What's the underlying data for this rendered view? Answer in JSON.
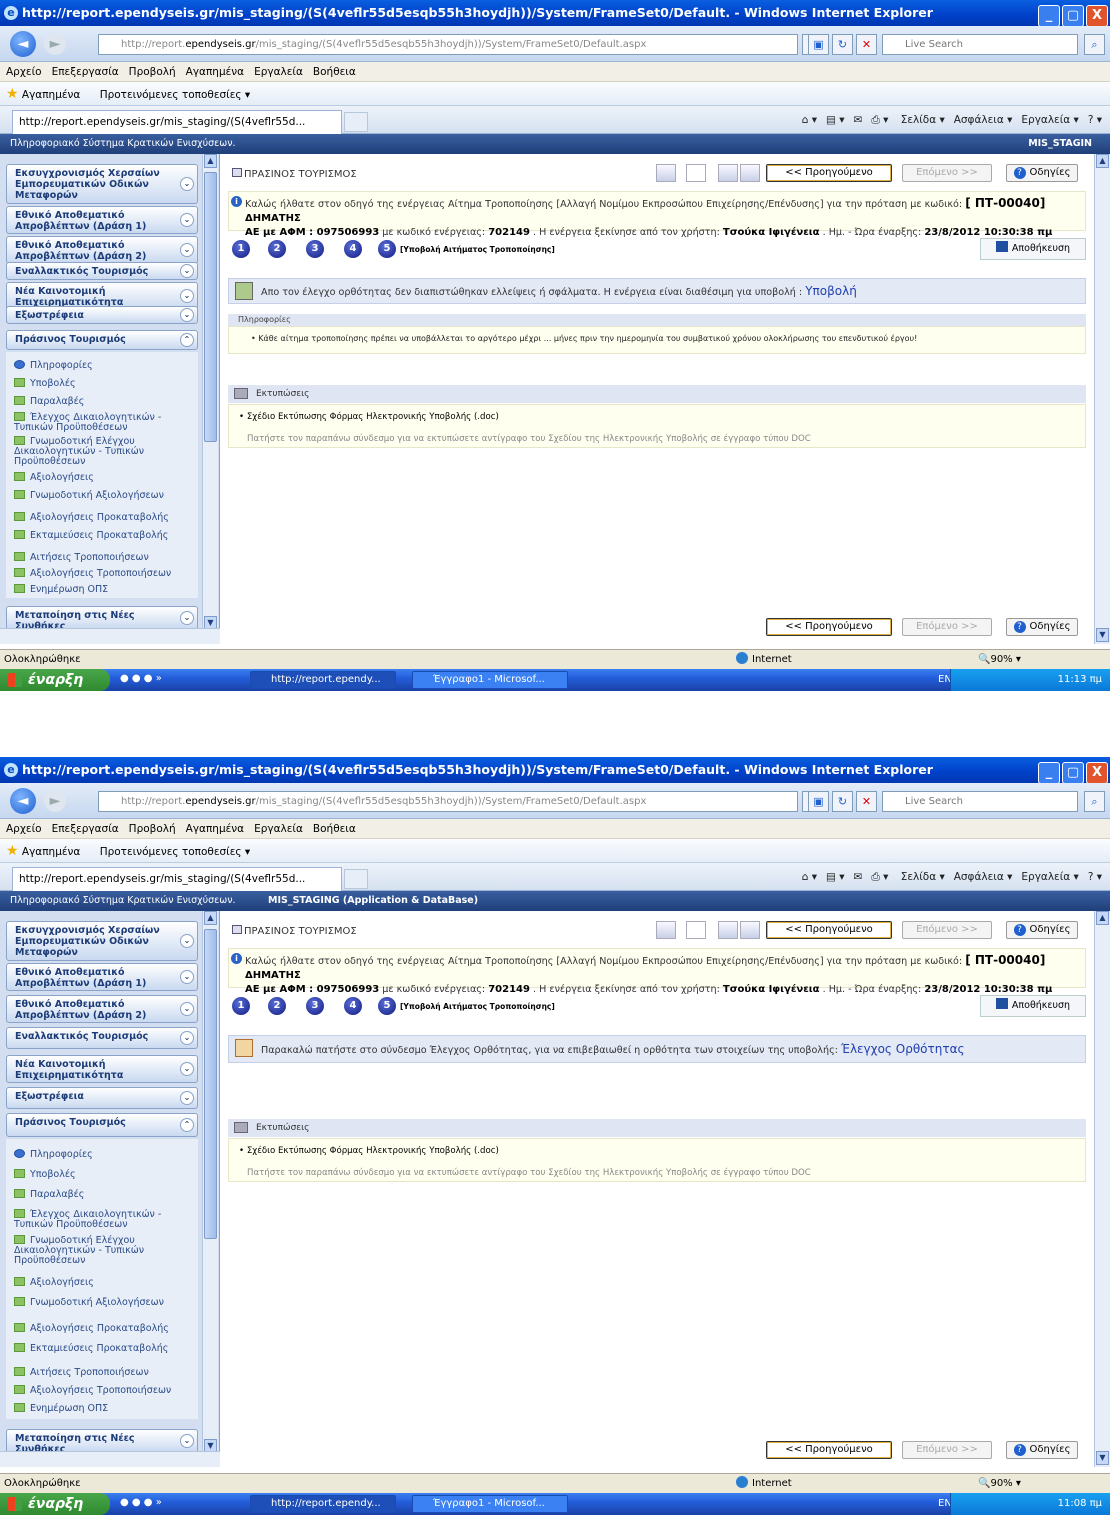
{
  "window": {
    "title": "http://report.ependyseis.gr/mis_staging/(S(4veflr55d5esqb55h3hoydjh))/System/FrameSet0/Default. - Windows Internet Explorer",
    "min": "_",
    "max": "▢",
    "close": "X"
  },
  "address": {
    "url_prefix": "http://report.",
    "url_domain": "ependyseis.gr",
    "url_rest": "/mis_staging/(S(4veflr55d5esqb55h3hoydjh))/System/FrameSet0/Default.aspx",
    "search_placeholder": "Live Search"
  },
  "menu": [
    "Αρχείο",
    "Επεξεργασία",
    "Προβολή",
    "Αγαπημένα",
    "Εργαλεία",
    "Βοήθεια"
  ],
  "favorites": {
    "label": "Αγαπημένα",
    "suggested": "Προτεινόμενες τοποθεσίες ▾"
  },
  "tab": {
    "label": "http://report.ependyseis.gr/mis_staging/(S(4veflr55d..."
  },
  "commandbar": {
    "page": "Σελίδα ▾",
    "safety": "Ασφάλεια ▾",
    "tools": "Εργαλεία ▾"
  },
  "app": {
    "header_title": "Πληροφοριακό Σύστημα Κρατικών Ενισχύσεων.",
    "system_top": "MIS_STAGIN",
    "system_bottom": "MIS_STAGING (Application & DataBase)"
  },
  "sidebar": {
    "sections": [
      {
        "label": "Εκσυγχρονισμός Χερσαίων Εμπορευματικών Οδικών Μεταφορών"
      },
      {
        "label": "Εθνικό Αποθεματικό Απροβλέπτων (Δράση 1)"
      },
      {
        "label": "Εθνικό Αποθεματικό Απροβλέπτων (Δράση 2)"
      },
      {
        "label": "Εναλλακτικός Τουρισμός"
      },
      {
        "label": "Νέα Καινοτομική Επιχειρηματικότητα"
      },
      {
        "label": "Εξωστρέφεια"
      },
      {
        "label": "Πράσινος Τουρισμός"
      },
      {
        "label": "Μεταποίηση στις Νέες Συνθήκες"
      }
    ],
    "items": [
      "Πληροφορίες",
      "Υποβολές",
      "Παραλαβές",
      "Έλεγχος Δικαιολογητικών - Τυπικών Προϋποθέσεων",
      "Γνωμοδοτική Ελέγχου Δικαιολογητικών - Τυπικών Προϋποθέσεων",
      "Αξιολογήσεις",
      "Γνωμοδοτική Αξιολογήσεων",
      "Αξιολογήσεις Προκαταβολής",
      "Εκταμιεύσεις Προκαταβολής",
      "Αιτήσεις Τροποποιήσεων",
      "Αξιολογήσεις Τροποποιήσεων",
      "Ενημέρωση ΟΠΣ"
    ]
  },
  "content": {
    "title": "ΠΡΑΣΙΝΟΣ ΤΟΥΡΙΣΜΟΣ",
    "prev": "<< Προηγούμενο",
    "next": "Επόμενο >>",
    "help": "Οδηγίες",
    "welcome_1": "Καλώς ήλθατε στον οδηγό της ενέργειας Αίτημα Τροποποίησης [Αλλαγή Νομίμου Εκπροσώπου Επιχείρησης/Επένδυσης] για την πρόταση με κωδικό:",
    "code": "[ ΠΤ-00040]",
    "company": "ΔΗΜΑΤΗΣ",
    "company_2": "ΑΕ με ΑΦΜ : 097506993",
    "welcome_2": "με κωδικό ενέργειας:",
    "action_code": "702149",
    "welcome_3": ". Η ενέργεια ξεκίνησε από τον χρήστη:",
    "user": "Τσούκα Ιφιγένεια",
    "welcome_4": ". Ημ. - Ώρα έναρξης:",
    "start_dt": "23/8/2012 10:30:38 πμ",
    "steps": [
      "1",
      "2",
      "3",
      "4",
      "5"
    ],
    "step_label": "[Υποβολή Αιτήματος Τροποποίησης]",
    "save": "Αποθήκευση",
    "msg_ok": "Απο τον έλεγχο ορθότητας δεν διαπιστώθηκαν ελλείψεις ή σφάλματα. Η ενέργεια είναι διαθέσιμη για υποβολή :",
    "msg_ok_link": "Υποβολή",
    "info_head": "Πληροφορίες",
    "info_text": "Κάθε αίτημα τροποποίησης πρέπει να υποβάλλεται το αργότερο μέχρι ... μήνες πριν την ημερομηνία του συμβατικού χρόνου ολοκλήρωσης του επενδυτικού έργου!",
    "msg_check": "Παρακαλώ πατήστε στο σύνδεσμο Έλεγχος Ορθότητας, για να επιβεβαιωθεί η ορθότητα των στοιχείων της υποβολής:",
    "msg_check_link": "Έλεγχος Ορθότητας",
    "prints_head": "Εκτυπώσεις",
    "prints_link": "Σχέδιο Εκτύπωσης Φόρμας Ηλεκτρονικής Υποβολής (.doc)",
    "prints_sub": "Πατήστε τον παραπάνω σύνδεσμο για να εκτυπώσετε αντίγραφο του Σχεδίου της Ηλεκτρονικής Υποβολής σε έγγραφο τύπου DOC"
  },
  "status": {
    "done": "Ολοκληρώθηκε",
    "zone": "Internet",
    "zoom": "90%"
  },
  "taskbar": {
    "start": "έναρξη",
    "task_ie": "http://report.ependy...",
    "task_word": "Έγγραφο1 - Microsof...",
    "lang": "EN",
    "time_top": "11:13 πμ",
    "time_bottom": "11:08 πμ"
  },
  "colors": {
    "xp_blue": "#0a5fe0",
    "app_header": "#1f3f7a",
    "sidebar_bg": "#d3dff0"
  }
}
